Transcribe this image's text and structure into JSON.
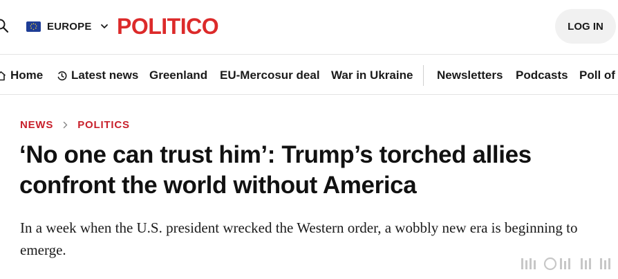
{
  "header": {
    "search_icon": "search-icon",
    "edition_label": "EUROPE",
    "logo": "POLITICO",
    "login_label": "LOG IN"
  },
  "nav": {
    "items": [
      {
        "label": "Home",
        "icon": "home-icon"
      },
      {
        "label": "Latest news",
        "icon": "clock-icon"
      },
      {
        "label": "Greenland"
      },
      {
        "label": "EU-Mercosur deal"
      },
      {
        "label": "War in Ukraine"
      },
      {
        "label": "Newsletters"
      },
      {
        "label": "Podcasts"
      },
      {
        "label": "Poll of P"
      }
    ]
  },
  "article": {
    "breadcrumb": [
      "NEWS",
      "POLITICS"
    ],
    "headline": "‘No one can trust him’: Trump’s torched allies confront the world without America",
    "dek": "In a week when the U.S. president wrecked the Western order, a wobbly new era is beginning to emerge."
  },
  "colors": {
    "brand_red": "#dc2a2a",
    "breadcrumb_red": "#c8202b",
    "eu_blue": "#1e3d96",
    "login_bg": "#f1f1f1"
  }
}
